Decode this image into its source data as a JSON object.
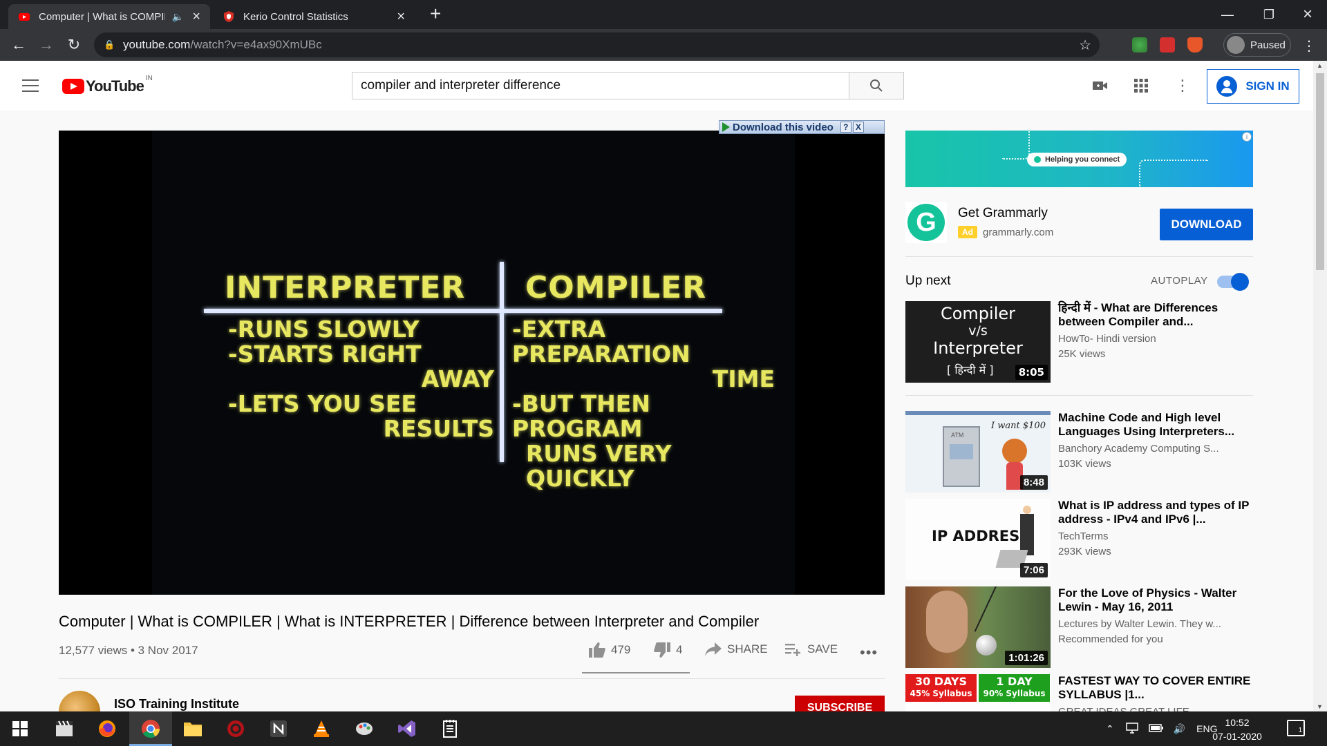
{
  "browser": {
    "tabs": [
      {
        "title": "Computer | What is COMPILE",
        "favicon": "youtube-icon",
        "active": true,
        "audio": true
      },
      {
        "title": "Kerio Control Statistics",
        "favicon": "kerio-shield-icon",
        "active": false
      }
    ],
    "url_host": "youtube.com",
    "url_path": "/watch?v=e4ax90XmUBc",
    "profile_status": "Paused"
  },
  "youtube": {
    "logo_text": "YouTube",
    "region": "IN",
    "search_value": "compiler and interpreter difference",
    "sign_in_label": "SIGN IN"
  },
  "player": {
    "download_bar": "Download this video",
    "download_help": "?",
    "download_close": "X",
    "board": {
      "left_heading": "INTERPRETER",
      "right_heading": "COMPILER",
      "left_lines": [
        "-RUNS SLOWLY",
        "-STARTS RIGHT",
        "AWAY",
        "-LETS YOU SEE",
        "RESULTS"
      ],
      "right_lines": [
        "-EXTRA PREPARATION",
        "TIME",
        "-BUT THEN PROGRAM",
        "RUNS  VERY QUICKLY"
      ]
    }
  },
  "video": {
    "title": "Computer | What is COMPILER | What is INTERPRETER | Difference between Interpreter and Compiler",
    "stats": "12,577 views • 3 Nov 2017",
    "likes": "479",
    "dislikes": "4",
    "share_label": "SHARE",
    "save_label": "SAVE",
    "like_ratio": 0.99,
    "channel": "ISO Training Institute",
    "subscribe_label": "SUBSCRIBE"
  },
  "ad": {
    "banner_text": "Helping you connect",
    "name": "Get Grammarly",
    "badge": "Ad",
    "domain": "grammarly.com",
    "cta": "DOWNLOAD",
    "info": "i",
    "logo_letter": "G"
  },
  "upnext": {
    "heading": "Up next",
    "autoplay_label": "AUTOPLAY",
    "autoplay_on": true,
    "items": [
      {
        "title": "हिन्दी में - What are Differences between Compiler and...",
        "channel": "HowTo- Hindi version",
        "views": "25K views",
        "duration": "8:05",
        "thumb_lines": [
          "Compiler",
          "v/s",
          "Interpreter",
          "[ हिन्दी में ]"
        ]
      },
      {
        "title": "Machine Code and High level Languages Using Interpreters...",
        "channel": "Banchory Academy Computing S...",
        "views": "103K views",
        "duration": "8:48",
        "thumb_text": "I want $100"
      },
      {
        "title": "What is IP address and types of IP address - IPv4 and IPv6 |...",
        "channel": "TechTerms",
        "views": "293K views",
        "duration": "7:06",
        "thumb_text": "IP ADDRESS"
      },
      {
        "title": "For the Love of Physics - Walter Lewin - May 16, 2011",
        "channel": "Lectures by Walter Lewin. They w...",
        "views": "Recommended for you",
        "duration": "1:01:26"
      },
      {
        "title": "FASTEST WAY TO COVER ENTIRE SYLLABUS |1...",
        "channel": "GREAT IDEAS GREAT LIFE",
        "views": "",
        "thumb_blocks": [
          {
            "a": "30 DAYS",
            "b": "45% Syllabus",
            "color": "#e11b1b"
          },
          {
            "a": "1 DAY",
            "b": "90% Syllabus",
            "color": "#1ea01e"
          }
        ]
      }
    ]
  },
  "taskbar": {
    "language": "ENG",
    "time": "10:52",
    "date": "07-01-2020",
    "notifications": "1"
  }
}
